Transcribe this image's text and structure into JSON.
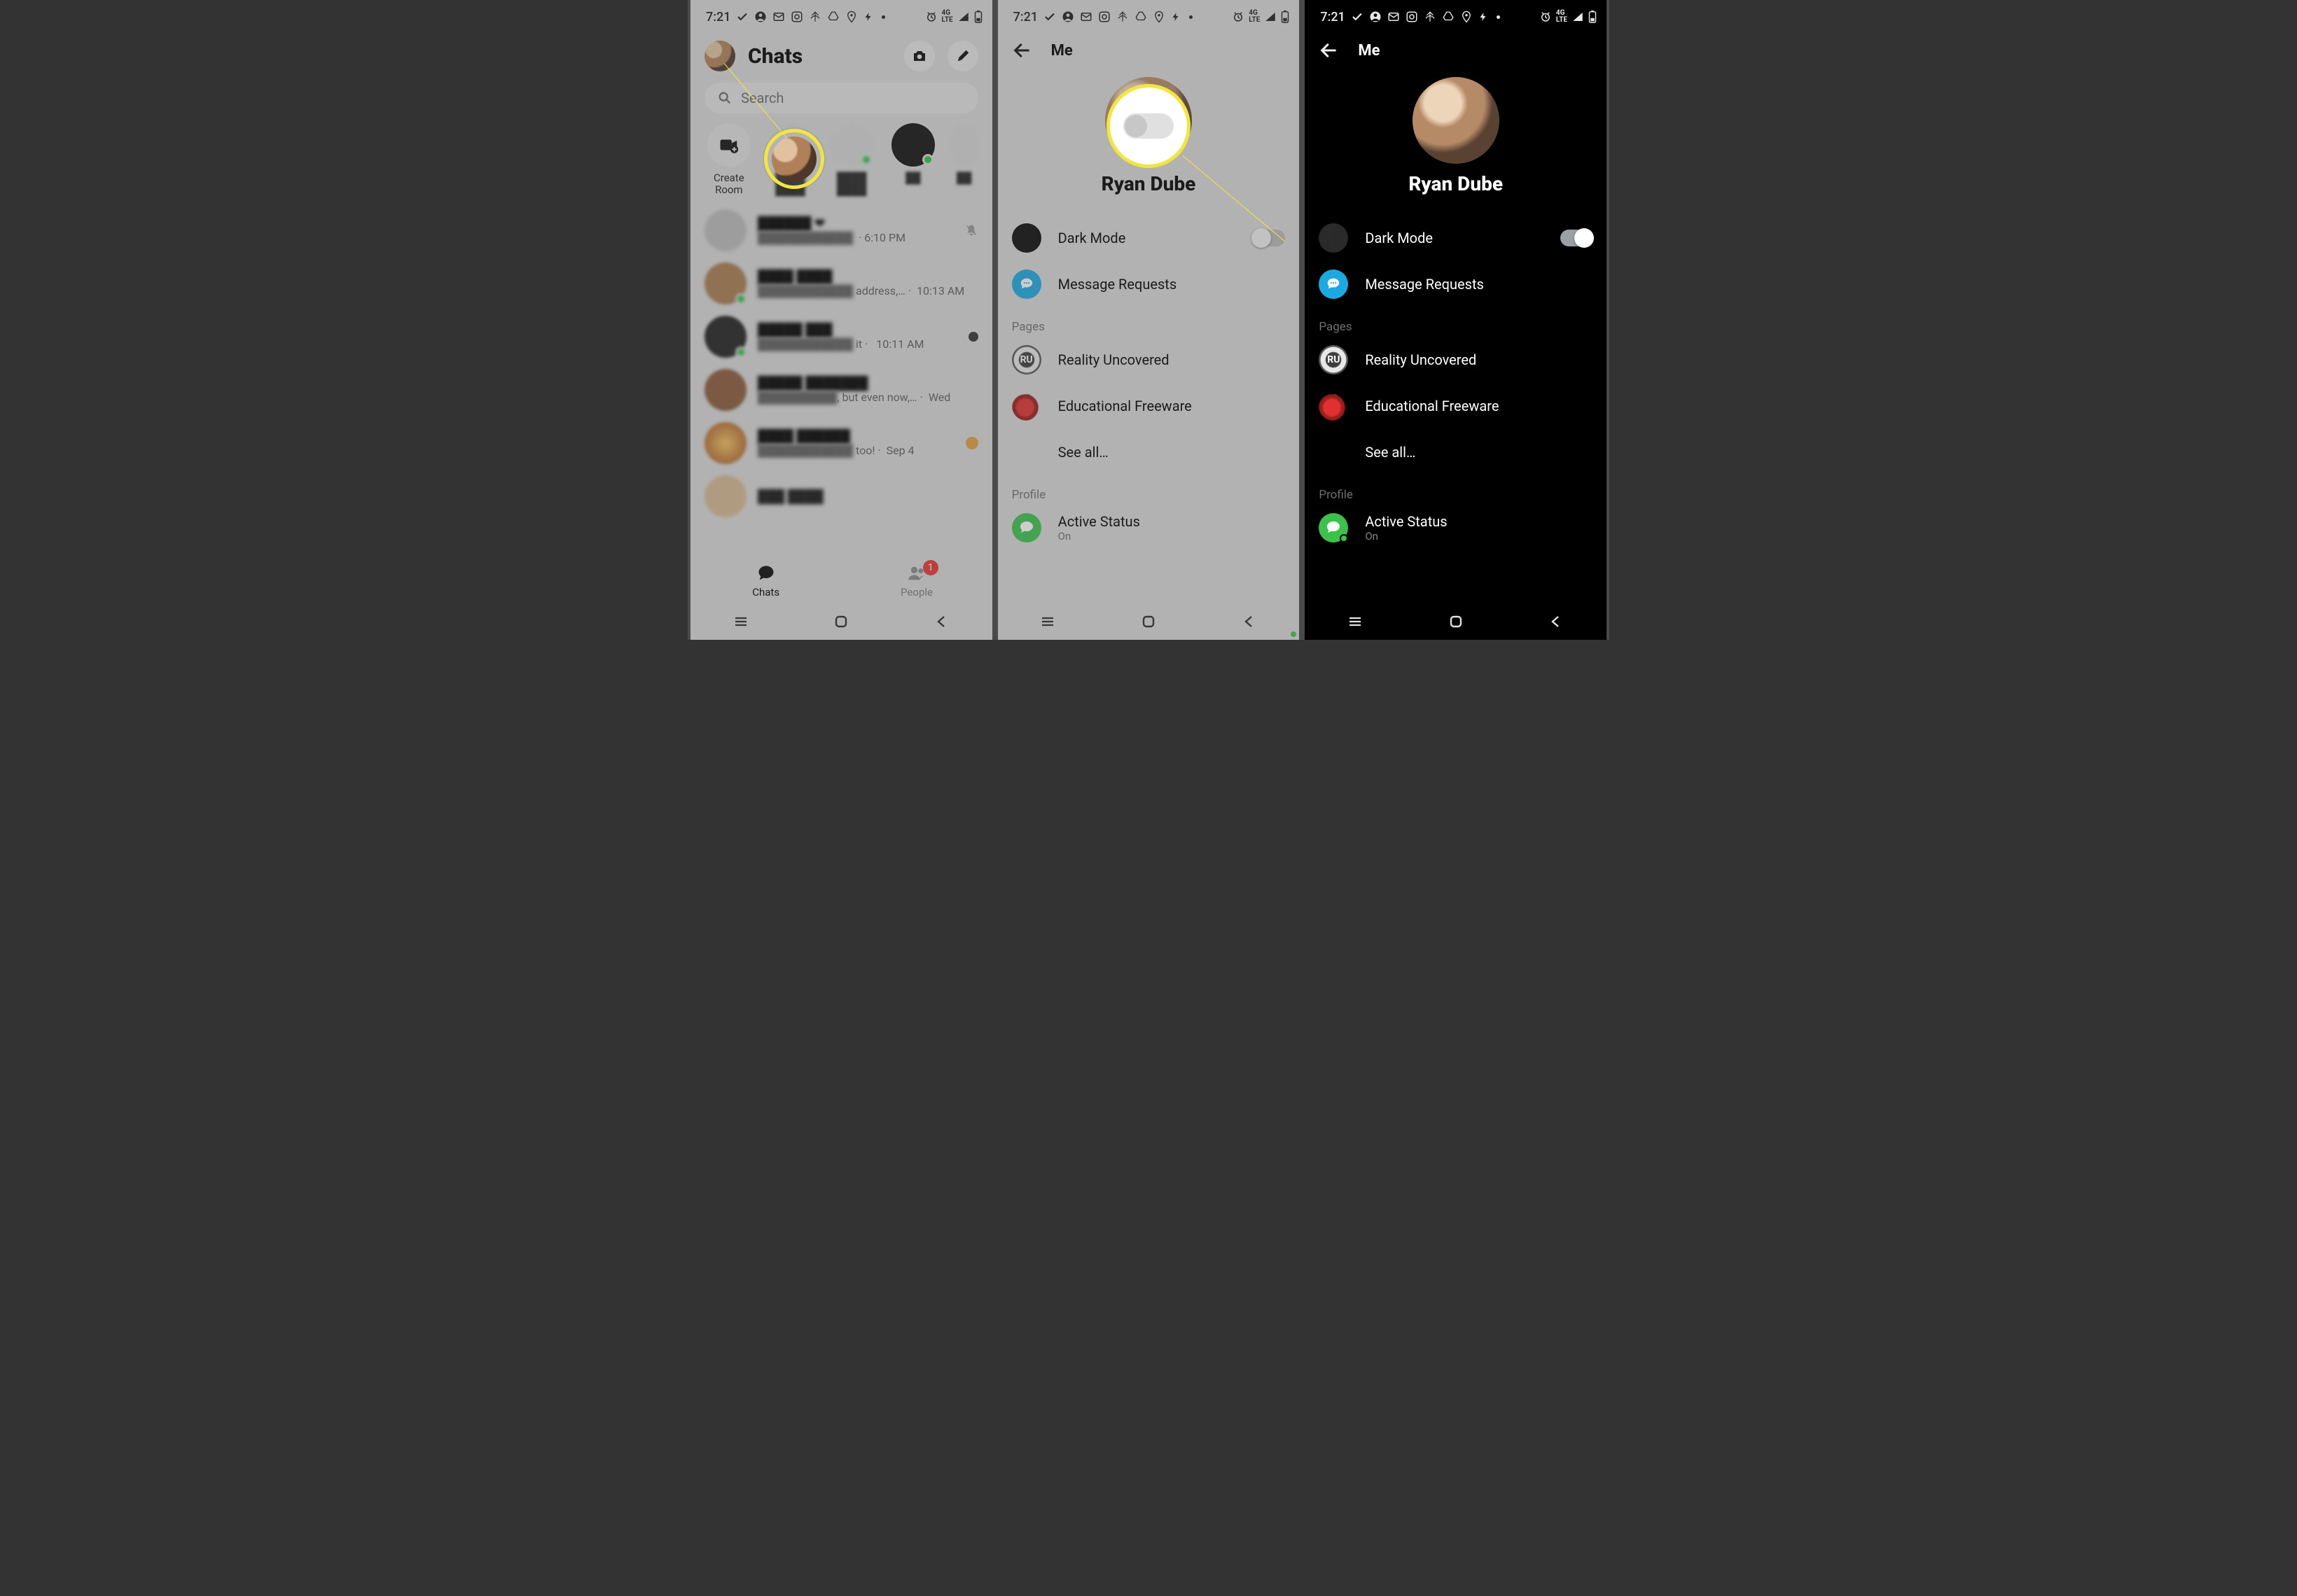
{
  "status": {
    "time": "7:21"
  },
  "chats": {
    "title": "Chats",
    "search_placeholder": "Search",
    "create_room": "Create Room",
    "tabs": {
      "chats": "Chats",
      "people": "People",
      "people_badge": "1"
    },
    "rows": [
      {
        "t": "6:10 PM"
      },
      {
        "t": "10:13 AM",
        "suffix": "address,…  ·"
      },
      {
        "t": "10:11 AM",
        "suffix": "it ·"
      },
      {
        "t": "Wed",
        "suffix": ", but even now,…  ·"
      },
      {
        "t": "Sep 4",
        "suffix": "too! ·"
      }
    ]
  },
  "me": {
    "header": "Me",
    "name": "Ryan Dube",
    "dark_mode": "Dark Mode",
    "message_requests": "Message Requests",
    "section_pages": "Pages",
    "page1": "Reality Uncovered",
    "page2": "Educational Freeware",
    "see_all": "See all…",
    "section_profile": "Profile",
    "active_status": "Active Status",
    "active_status_sub": "On"
  }
}
